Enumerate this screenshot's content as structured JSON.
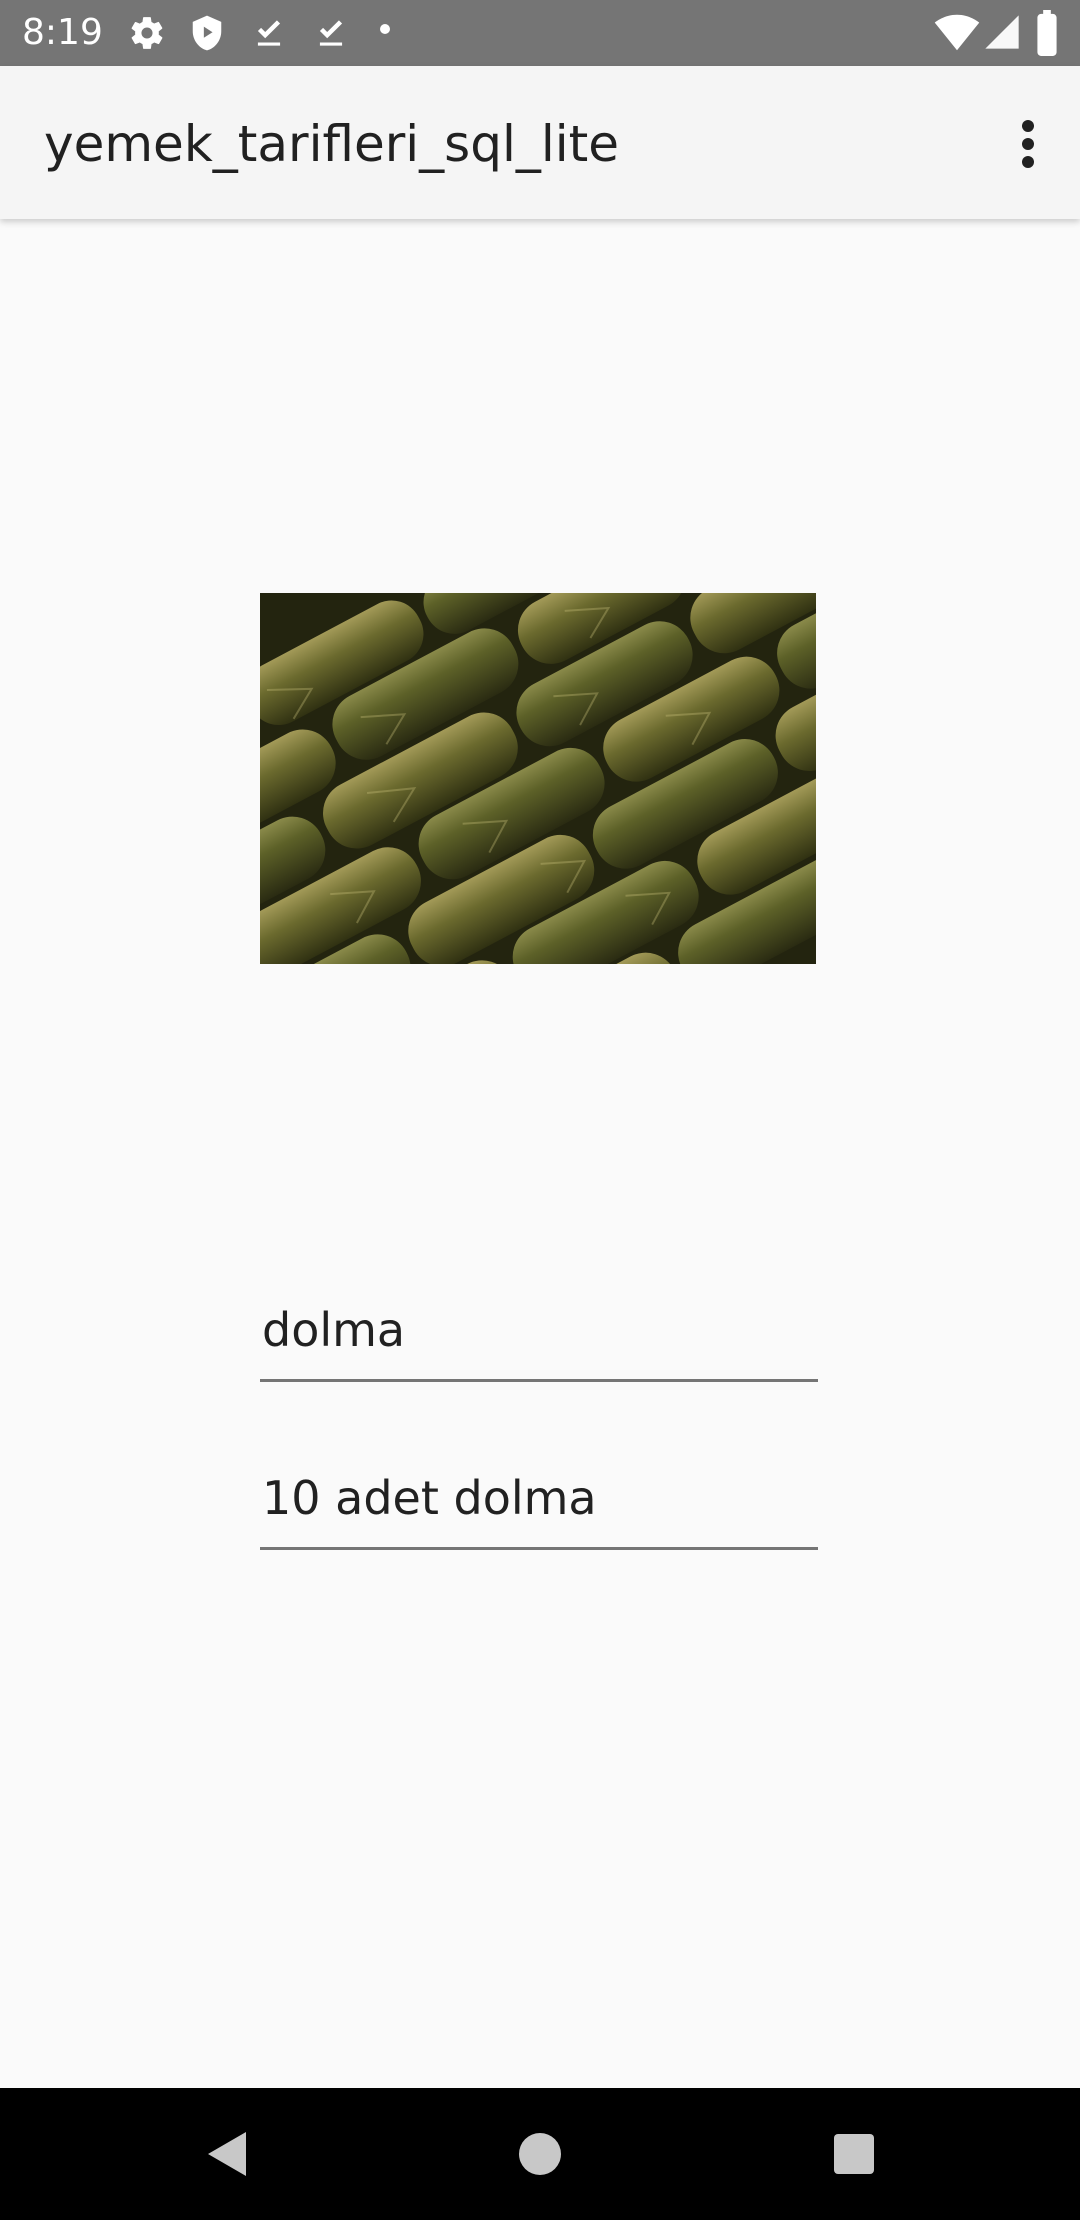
{
  "status_bar": {
    "time": "8:19",
    "left_icons": [
      "gear-icon",
      "shield-play-icon",
      "download-done-icon",
      "download-done-icon",
      "dot-icon"
    ],
    "right_icons": [
      "wifi-icon",
      "signal-icon",
      "battery-icon"
    ]
  },
  "app_bar": {
    "title": "yemek_tarifleri_sql_lite",
    "menu_icon": "more-vert-icon"
  },
  "content": {
    "image_subject": "dolma",
    "name_field": "dolma",
    "description_field": "10 adet dolma"
  },
  "nav_bar": {
    "buttons": [
      "back-icon",
      "home-icon",
      "recents-icon"
    ]
  },
  "colors": {
    "status_bar": "#757575",
    "app_bar": "#f5f5f5",
    "background": "#fafafa",
    "nav_bar": "#000000",
    "underline": "#757575"
  }
}
